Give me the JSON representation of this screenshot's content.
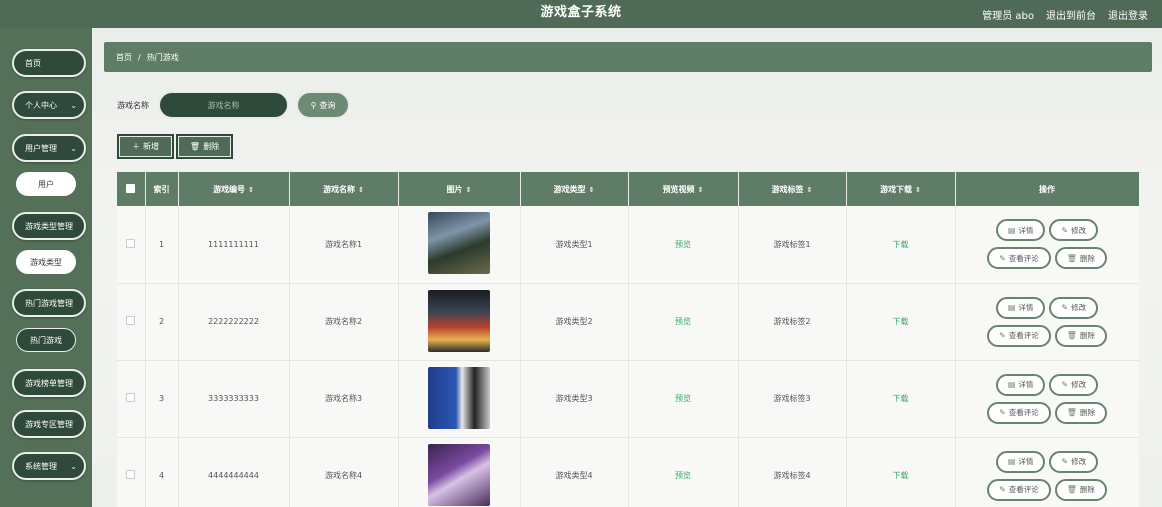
{
  "header": {
    "title": "游戏盒子系统",
    "user_label": "管理员 abo",
    "exit_front": "退出到前台",
    "logout": "退出登录"
  },
  "sidebar": {
    "items": [
      {
        "label": "首页"
      },
      {
        "label": "个人中心"
      },
      {
        "label": "用户管理"
      },
      {
        "label": "用户"
      },
      {
        "label": "游戏类型管理"
      },
      {
        "label": "游戏类型"
      },
      {
        "label": "热门游戏管理"
      },
      {
        "label": "热门游戏"
      },
      {
        "label": "游戏榜单管理"
      },
      {
        "label": "游戏专区管理"
      },
      {
        "label": "系统管理"
      }
    ]
  },
  "breadcrumb": {
    "home": "首页",
    "sep": "/",
    "current": "热门游戏"
  },
  "search": {
    "label": "游戏名称",
    "placeholder": "游戏名称",
    "button": "查询"
  },
  "actions": {
    "add": "新增",
    "delete": "删除"
  },
  "table": {
    "headers": [
      "索引",
      "游戏编号",
      "游戏名称",
      "图片",
      "游戏类型",
      "预览视频",
      "游戏标签",
      "游戏下载",
      "操作"
    ],
    "rows": [
      {
        "index": "1",
        "code": "1111111111",
        "name": "游戏名称1",
        "type": "游戏类型1",
        "preview": "预览",
        "tag": "游戏标签1",
        "download": "下载"
      },
      {
        "index": "2",
        "code": "2222222222",
        "name": "游戏名称2",
        "type": "游戏类型2",
        "preview": "预览",
        "tag": "游戏标签2",
        "download": "下载"
      },
      {
        "index": "3",
        "code": "3333333333",
        "name": "游戏名称3",
        "type": "游戏类型3",
        "preview": "预览",
        "tag": "游戏标签3",
        "download": "下载"
      },
      {
        "index": "4",
        "code": "4444444444",
        "name": "游戏名称4",
        "type": "游戏类型4",
        "preview": "预览",
        "tag": "游戏标签4",
        "download": "下载"
      }
    ],
    "ops": {
      "detail": "详情",
      "edit": "修改",
      "comments": "查看评论",
      "delete": "删除"
    }
  },
  "colors": {
    "primary": "#4f6a57",
    "dark": "#2f4a3a",
    "header_bg": "#5f7c66",
    "link_green": "#3aa56a"
  }
}
